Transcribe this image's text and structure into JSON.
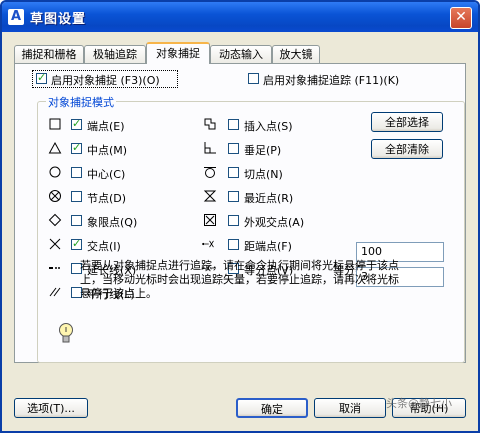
{
  "window": {
    "title": "草图设置",
    "app_icon": "autocad-icon",
    "close_glyph": "✕"
  },
  "tabs": [
    {
      "label": "捕捉和栅格"
    },
    {
      "label": "极轴追踪"
    },
    {
      "label": "对象捕捉"
    },
    {
      "label": "动态输入"
    },
    {
      "label": "放大镜"
    }
  ],
  "active_tab": 2,
  "osnap": {
    "enable_label": "启用对象捕捉 (F3)(O)",
    "enable_checked": true,
    "track_label": "启用对象捕捉追踪 (F11)(K)",
    "track_checked": false
  },
  "modes_group_title": "对象捕捉模式",
  "modes_left": [
    {
      "label": "端点(E)",
      "checked": true,
      "icon": "endpoint-square-icon"
    },
    {
      "label": "中点(M)",
      "checked": true,
      "icon": "midpoint-triangle-icon"
    },
    {
      "label": "中心(C)",
      "checked": false,
      "icon": "center-circle-icon"
    },
    {
      "label": "节点(D)",
      "checked": false,
      "icon": "node-icon"
    },
    {
      "label": "象限点(Q)",
      "checked": false,
      "icon": "quadrant-diamond-icon"
    },
    {
      "label": "交点(I)",
      "checked": true,
      "icon": "intersection-x-icon"
    },
    {
      "label": "延长线(X)",
      "checked": false,
      "icon": "extension-icon"
    },
    {
      "label": "平行线(L)",
      "checked": false,
      "icon": "parallel-icon"
    }
  ],
  "modes_right": [
    {
      "label": "插入点(S)",
      "checked": false,
      "icon": "insertion-icon"
    },
    {
      "label": "垂足(P)",
      "checked": false,
      "icon": "perpendicular-icon"
    },
    {
      "label": "切点(N)",
      "checked": false,
      "icon": "tangent-icon"
    },
    {
      "label": "最近点(R)",
      "checked": false,
      "icon": "nearest-icon"
    },
    {
      "label": "外观交点(A)",
      "checked": false,
      "icon": "apparent-intersection-icon"
    },
    {
      "label": "距端点(F)",
      "checked": false,
      "icon": "from-endpoint-icon"
    },
    {
      "label": "等分点(V)",
      "checked": false,
      "icon": "divide-icon"
    }
  ],
  "buttons_side": {
    "select_all": "全部选择",
    "clear_all": "全部清除"
  },
  "distance_value": "100",
  "divide_label": "等分数",
  "divide_value": "3",
  "tip_text": "若要从对象捕捉点进行追踪，请在命令执行期间将光标悬停于该点上，当移动光标时会出现追踪矢量，若要停止追踪，请再次将光标悬停于该点上。",
  "footer": {
    "options": "选项(T)...",
    "ok": "确定",
    "cancel": "取消",
    "help": "帮助(H)"
  },
  "watermark": "头条@静七小"
}
